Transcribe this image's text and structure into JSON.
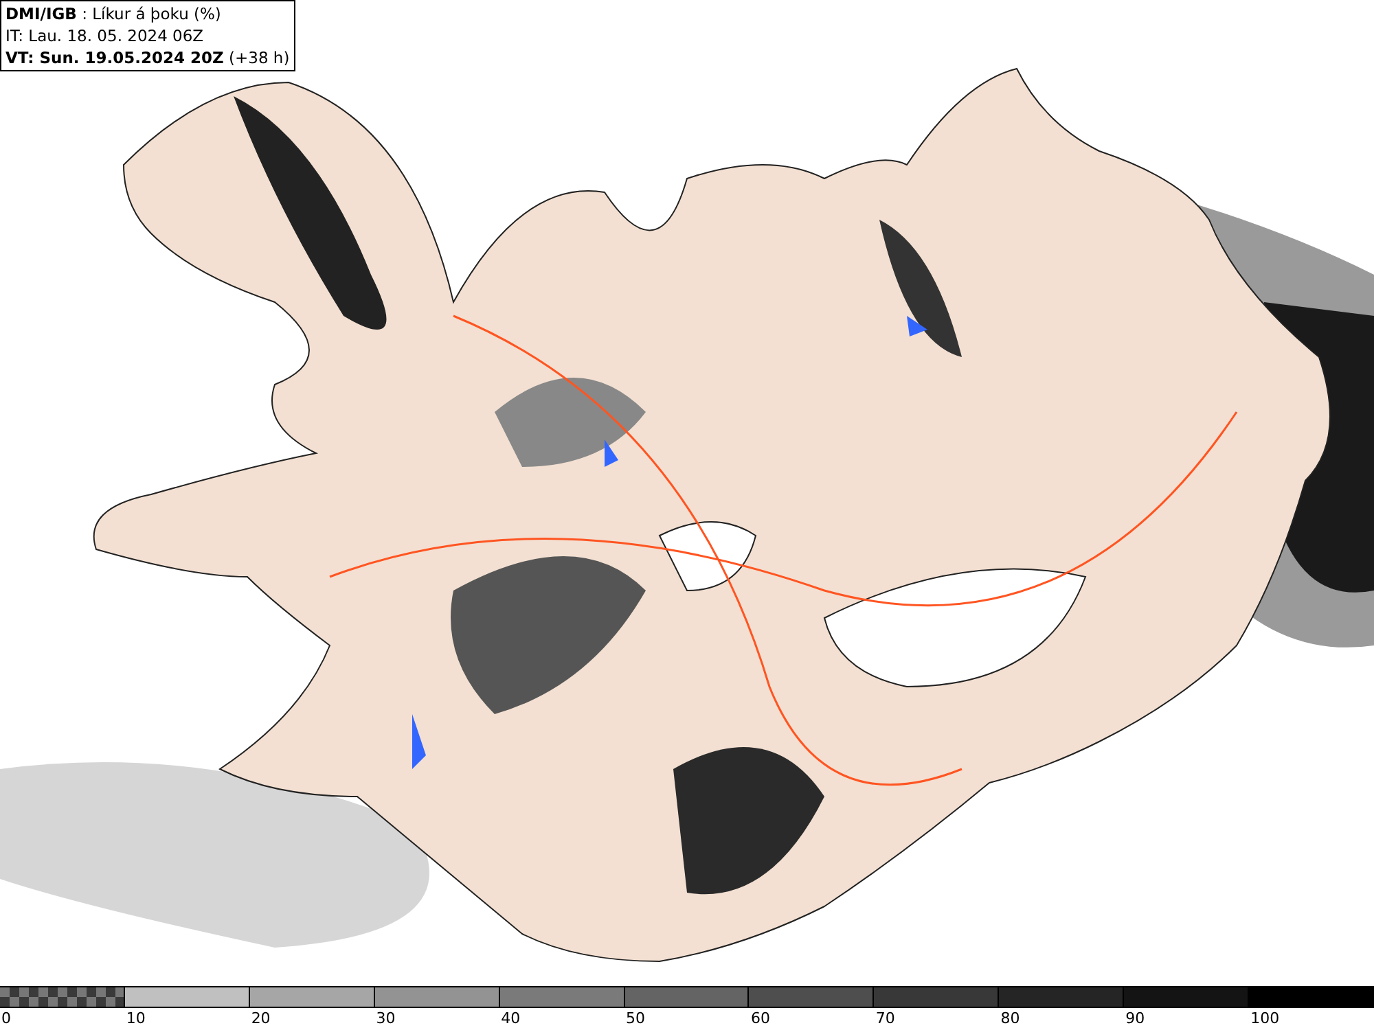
{
  "header": {
    "source": "DMI/IGB",
    "title": " : Líkur á þoku (%)",
    "issue_time": "IT: Lau. 18. 05. 2024 06Z",
    "valid_time": "VT: Sun. 19.05.2024 20Z",
    "offset": "(+38 h)"
  },
  "legend": {
    "swatches": [
      {
        "kind": "checkered",
        "color": "#3a3a3a"
      },
      {
        "kind": "solid",
        "color": "#c0c0c0"
      },
      {
        "kind": "solid",
        "color": "#a6a6a6"
      },
      {
        "kind": "solid",
        "color": "#939393"
      },
      {
        "kind": "solid",
        "color": "#7a7a7a"
      },
      {
        "kind": "solid",
        "color": "#646464"
      },
      {
        "kind": "solid",
        "color": "#4e4e4e"
      },
      {
        "kind": "solid",
        "color": "#383838"
      },
      {
        "kind": "solid",
        "color": "#252525"
      },
      {
        "kind": "solid",
        "color": "#141414"
      },
      {
        "kind": "solid",
        "color": "#000000"
      }
    ],
    "labels": [
      "0",
      "10",
      "20",
      "30",
      "40",
      "50",
      "60",
      "70",
      "80",
      "90",
      "100"
    ]
  }
}
